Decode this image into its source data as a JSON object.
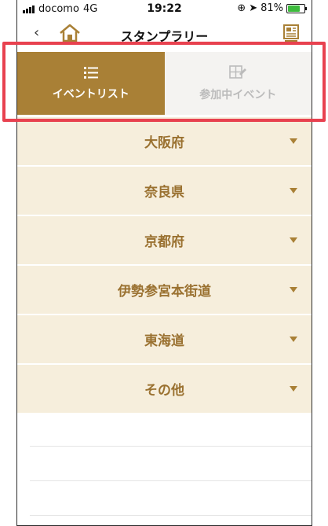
{
  "status_bar": {
    "carrier": "docomo",
    "network": "4G",
    "time": "19:22",
    "battery": "81%",
    "battery_level": 0.81
  },
  "header": {
    "title": "スタンプラリー"
  },
  "tabs": [
    {
      "label": "イベントリスト",
      "icon": "list-icon",
      "active": true
    },
    {
      "label": "参加中イベント",
      "icon": "stamp-card-icon",
      "active": false
    }
  ],
  "regions": [
    {
      "label": "大阪府"
    },
    {
      "label": "奈良県"
    },
    {
      "label": "京都府"
    },
    {
      "label": "伊勢参宮本街道"
    },
    {
      "label": "東海道"
    },
    {
      "label": "その他"
    }
  ],
  "colors": {
    "accent": "#a98036",
    "row_bg": "#f6eedc",
    "row_text": "#9a7130",
    "highlight": "#e8414f"
  }
}
